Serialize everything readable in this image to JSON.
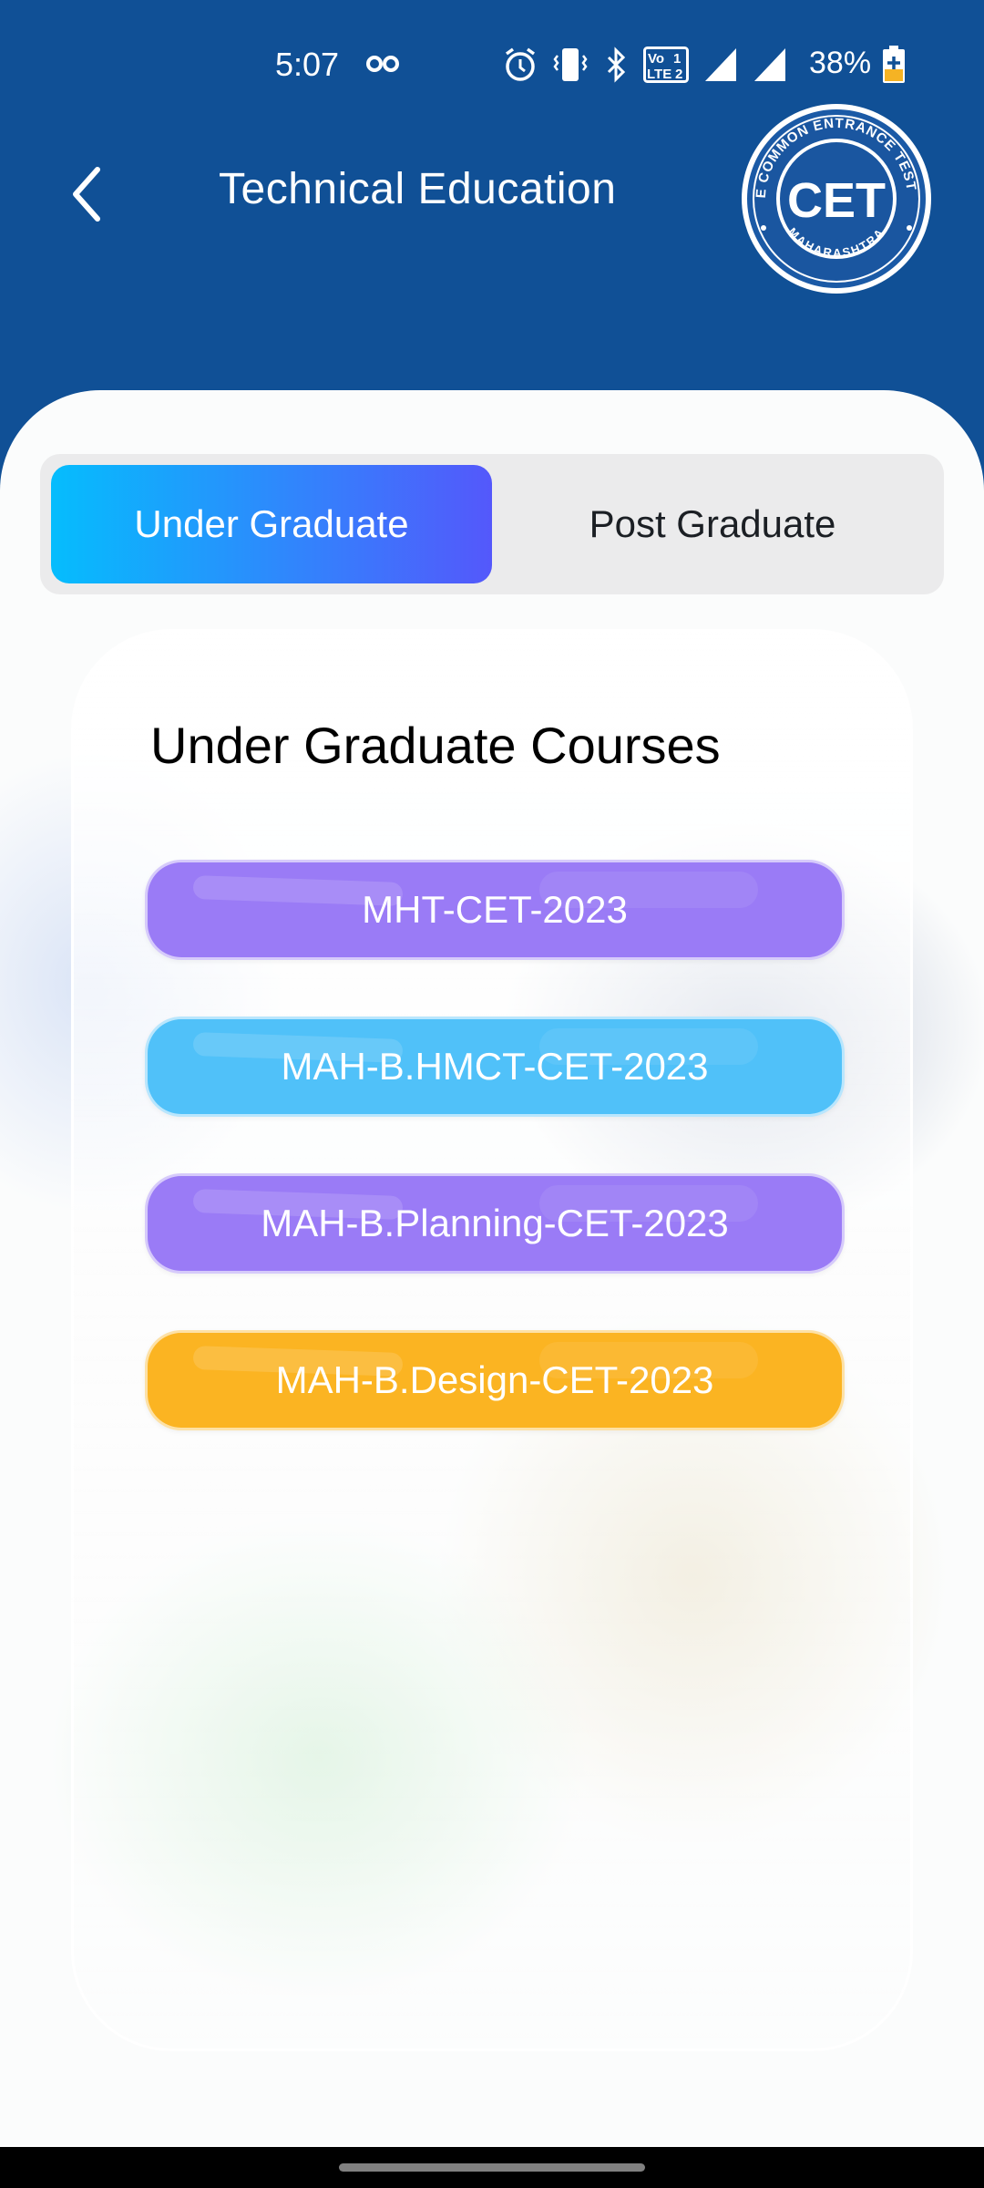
{
  "status_bar": {
    "time": "5:07",
    "battery_percent": "38%",
    "icons": [
      "glasses-icon",
      "alarm-icon",
      "vibrate-icon",
      "bluetooth-icon",
      "volte-lte-icon",
      "signal-icon",
      "signal-icon",
      "battery-charging-icon"
    ],
    "volte_label_top": "Vo",
    "volte_label_bottom": "LTE"
  },
  "app_bar": {
    "title": "Technical Education",
    "back_icon": "chevron-left-icon",
    "logo": {
      "center_text": "CET",
      "ring_text_top": "STATE COMMON ENTRANCE TEST CELL",
      "ring_text_bottom": "MAHARASHTRA"
    }
  },
  "colors": {
    "header_bg": "#105096",
    "tab_active_start": "#05bdfd",
    "tab_active_end": "#5458fb",
    "purple": "#9a7bf6",
    "sky": "#50c1f9",
    "amber": "#fbb422"
  },
  "tabs": [
    {
      "label": "Under Graduate",
      "active": true
    },
    {
      "label": "Post Graduate",
      "active": false
    }
  ],
  "card": {
    "title": "Under Graduate Courses",
    "courses": [
      {
        "label": "MHT-CET-2023",
        "color": "#9a7bf6"
      },
      {
        "label": "MAH-B.HMCT-CET-2023",
        "color": "#50c1f9"
      },
      {
        "label": "MAH-B.Planning-CET-2023",
        "color": "#9a7bf6"
      },
      {
        "label": "MAH-B.Design-CET-2023",
        "color": "#fbb422"
      }
    ]
  }
}
